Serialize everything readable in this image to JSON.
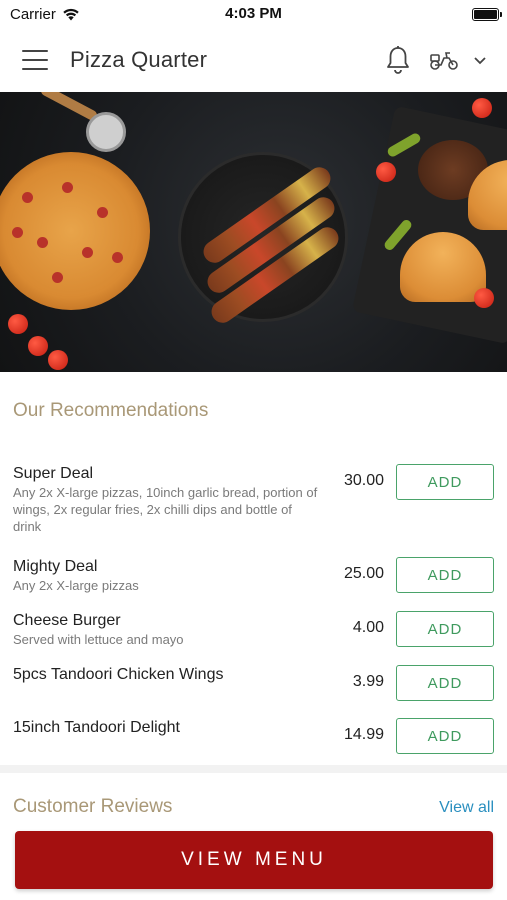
{
  "status_bar": {
    "carrier": "Carrier",
    "time": "4:03 PM"
  },
  "header": {
    "title": "Pizza Quarter",
    "icons": [
      "menu-icon",
      "bell-icon",
      "scooter-icon",
      "chevron-down-icon"
    ]
  },
  "recommendations": {
    "title": "Our Recommendations",
    "add_label": "ADD",
    "items": [
      {
        "name": "Super Deal",
        "description": "Any 2x X-large pizzas, 10inch garlic bread, portion of wings, 2x regular fries, 2x chilli dips and bottle of drink",
        "price": "30.00"
      },
      {
        "name": "Mighty Deal",
        "description": "Any 2x X-large pizzas",
        "price": "25.00"
      },
      {
        "name": "Cheese Burger",
        "description": "Served with lettuce and mayo",
        "price": "4.00"
      },
      {
        "name": "5pcs Tandoori Chicken Wings",
        "description": "",
        "price": "3.99"
      },
      {
        "name": "15inch Tandoori Delight",
        "description": "",
        "price": "14.99"
      }
    ]
  },
  "reviews": {
    "title": "Customer Reviews",
    "view_all": "View all"
  },
  "cta": {
    "label": "VIEW MENU"
  },
  "colors": {
    "accent_title": "#a99877",
    "add_green": "#4aa36a",
    "cta_red": "#a41010",
    "link_blue": "#2a8fbf"
  }
}
